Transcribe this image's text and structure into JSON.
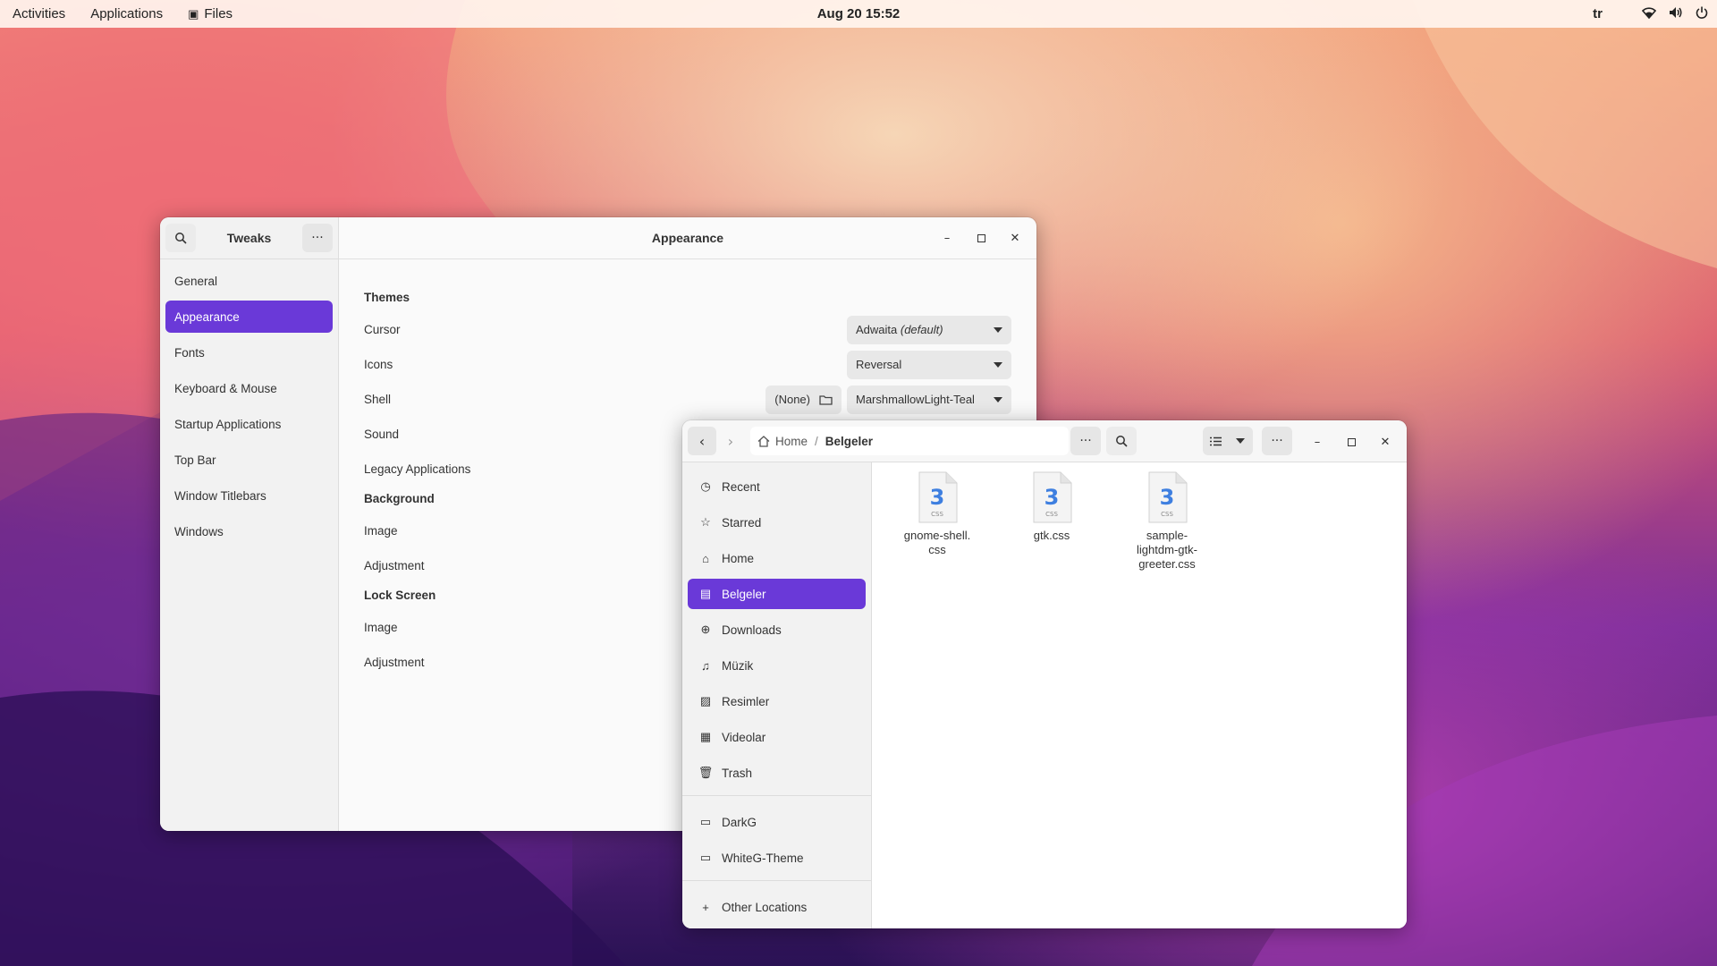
{
  "topbar": {
    "activities": "Activities",
    "applications": "Applications",
    "app_name": "Files",
    "clock": "Aug 20  15:52",
    "keyboard_layout": "tr"
  },
  "tweaks": {
    "sidebar_title": "Tweaks",
    "window_title": "Appearance",
    "nav": [
      "General",
      "Appearance",
      "Fonts",
      "Keyboard & Mouse",
      "Startup Applications",
      "Top Bar",
      "Window Titlebars",
      "Windows"
    ],
    "active_nav": "Appearance",
    "sections": {
      "themes": "Themes",
      "cursor_label": "Cursor",
      "cursor_value": "Adwaita",
      "cursor_suffix": "(default)",
      "icons_label": "Icons",
      "icons_value": "Reversal",
      "shell_label": "Shell",
      "shell_none": "(None)",
      "shell_value": "MarshmallowLight-Teal",
      "sound_label": "Sound",
      "legacy_label": "Legacy Applications",
      "background": "Background",
      "bg_image": "Image",
      "bg_adjustment": "Adjustment",
      "lock_screen": "Lock Screen",
      "ls_image": "Image",
      "ls_adjustment": "Adjustment"
    }
  },
  "files": {
    "path_home": "Home",
    "path_sep": "/",
    "path_current": "Belgeler",
    "places": [
      {
        "label": "Recent",
        "icon": "clock-icon"
      },
      {
        "label": "Starred",
        "icon": "star-icon"
      },
      {
        "label": "Home",
        "icon": "home-icon"
      },
      {
        "label": "Belgeler",
        "icon": "document-icon"
      },
      {
        "label": "Downloads",
        "icon": "download-icon"
      },
      {
        "label": "Müzik",
        "icon": "music-icon"
      },
      {
        "label": "Resimler",
        "icon": "image-icon"
      },
      {
        "label": "Videolar",
        "icon": "film-icon"
      },
      {
        "label": "Trash",
        "icon": "trash-icon"
      }
    ],
    "bookmarks": [
      {
        "label": "DarkG",
        "icon": "folder-icon"
      },
      {
        "label": "WhiteG-Theme",
        "icon": "folder-icon"
      }
    ],
    "other_locations": "Other Locations",
    "items": [
      {
        "name": "gnome-shell.\ncss",
        "icon_label": "CSS"
      },
      {
        "name": "gtk.css",
        "icon_label": "CSS"
      },
      {
        "name": "sample-\nlightdm-gtk-\ngreeter.css",
        "icon_label": "CSS"
      }
    ]
  },
  "colors": {
    "accent": "#6a39d8",
    "css_icon_blue": "#3e7fe0"
  }
}
